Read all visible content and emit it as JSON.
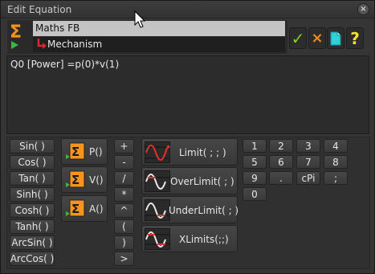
{
  "window": {
    "title": "Edit Equation",
    "close_glyph": "×"
  },
  "header": {
    "fb_name": "Maths FB",
    "mechanism": "Mechanism"
  },
  "toolbar": {
    "ok_glyph": "✓",
    "cancel_glyph": "×",
    "help_glyph": "?"
  },
  "editor": {
    "equation": "Q0 [Power] =p(0)*v(1)"
  },
  "trig": [
    "Sin( )",
    "Cos( )",
    "Tan( )",
    "Sinh( )",
    "Cosh( )",
    "Tanh( )",
    "ArcSin( )",
    "ArcCos( )"
  ],
  "functions": [
    "P()",
    "V()",
    "A()"
  ],
  "operators": [
    "+",
    "-",
    "/",
    "*",
    "^",
    "(",
    ")",
    ">"
  ],
  "limits": [
    "Limit( ; ; )",
    "OverLimit( ; )",
    "UnderLimit( ; )",
    "XLimits(;;)"
  ],
  "keypad": [
    [
      "1",
      "2",
      "3",
      "4"
    ],
    [
      "5",
      "6",
      "7",
      "8"
    ],
    [
      "9",
      ".",
      "cPi",
      ";"
    ],
    [
      "0"
    ]
  ],
  "colors": {
    "ok": "#7ed321",
    "cancel": "#f08a1c",
    "help": "#f2e22a",
    "sigma": "#f7941d",
    "selection": "#c4c4c4"
  }
}
